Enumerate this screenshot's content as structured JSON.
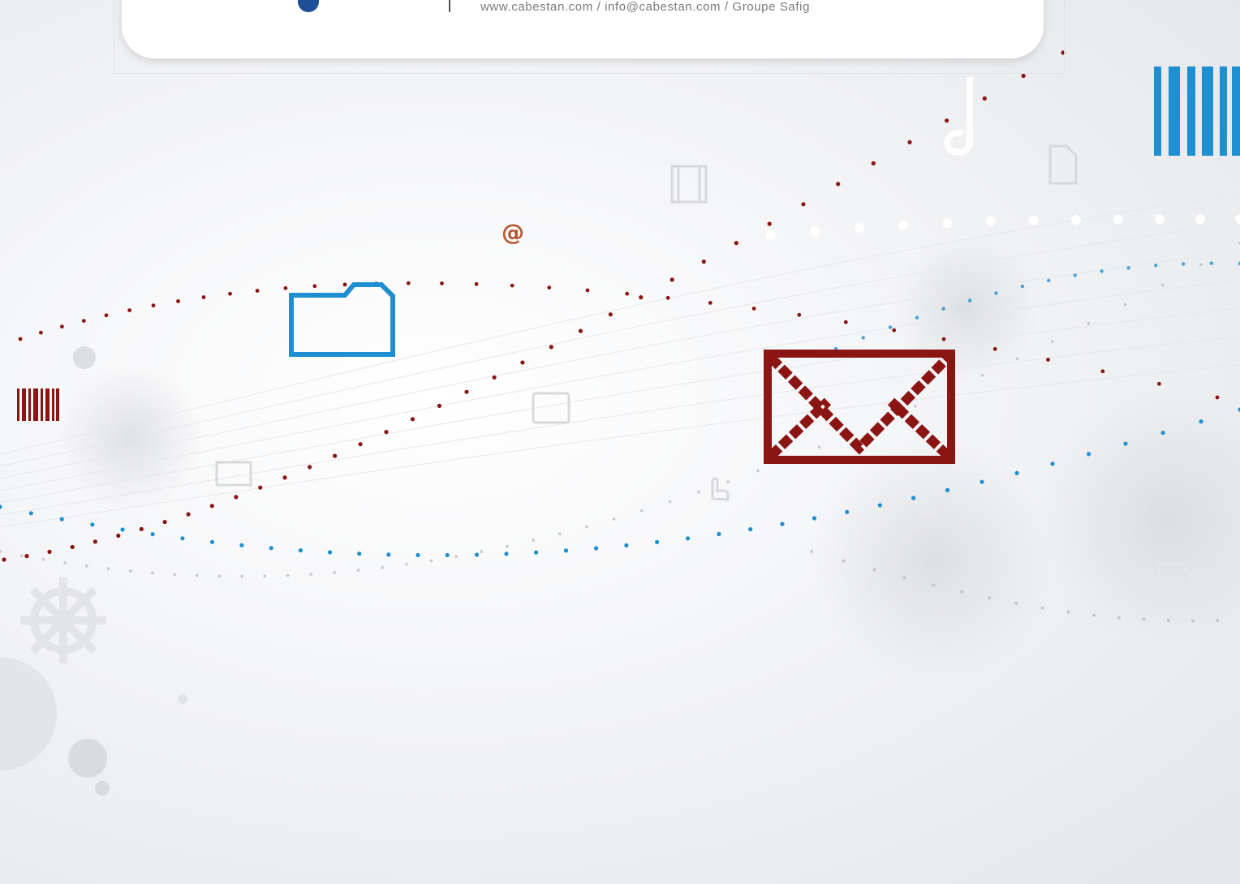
{
  "header": {
    "contact_line": "www.cabestan.com / info@cabestan.com / Groupe Safig"
  },
  "illustration": {
    "at_symbol": "@",
    "icons": [
      "envelope-icon",
      "folder-icon",
      "barcode-icon",
      "at-icon",
      "music-note-icon",
      "document-icon",
      "film-icon",
      "hand-pointer-icon",
      "steering-wheel-icon"
    ]
  },
  "colors": {
    "brand_blue": "#1f4e99",
    "accent_red": "#8b1512",
    "accent_blue": "#1e8fd0",
    "text_gray": "#7a7a7a"
  }
}
